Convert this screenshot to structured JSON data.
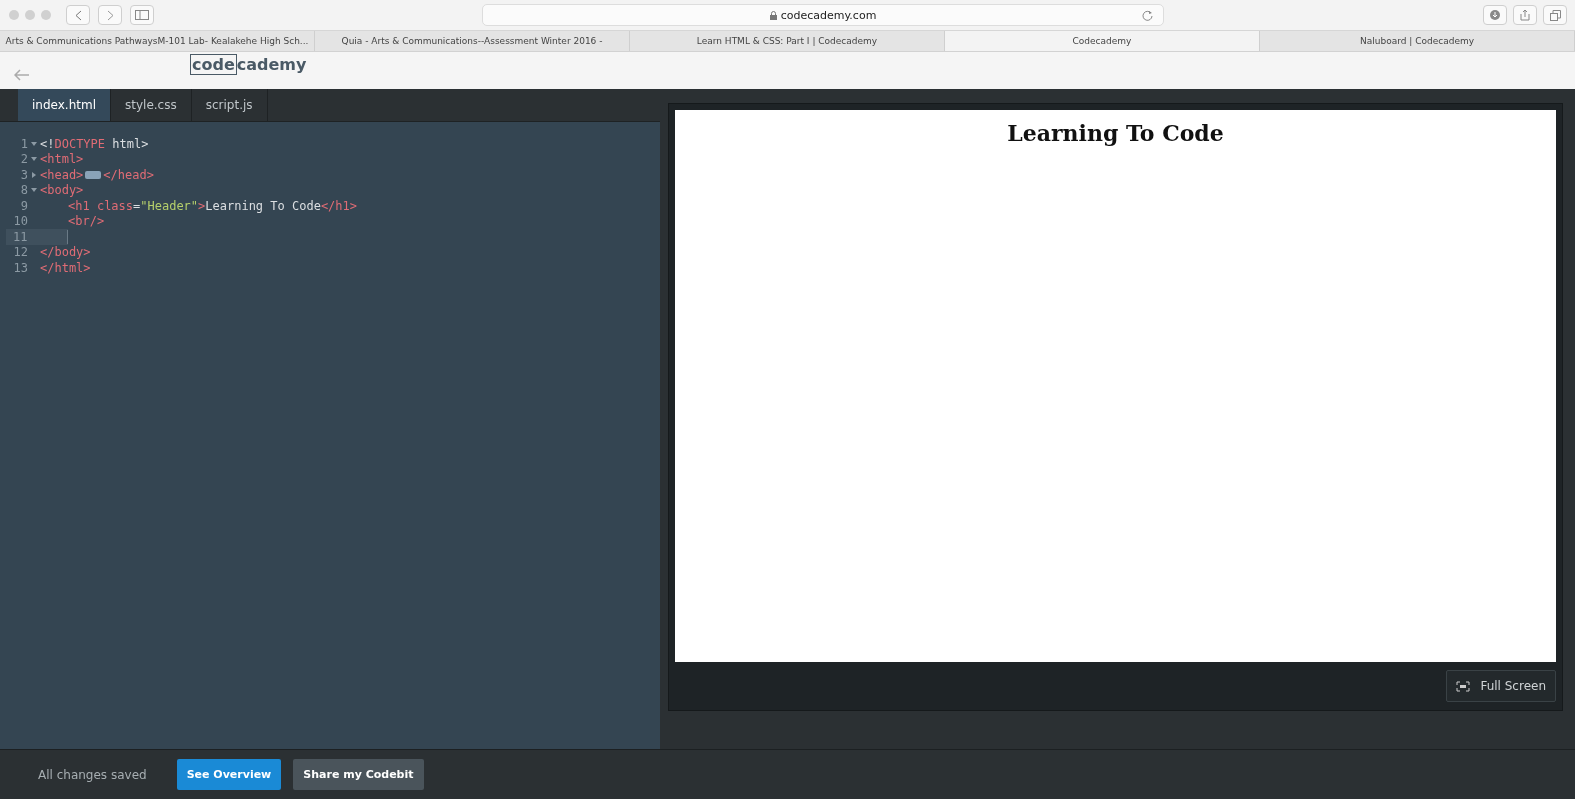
{
  "browser": {
    "address": "codecademy.com",
    "tabs": [
      {
        "label": "Arts & Communications PathwaysM-101 Lab- Kealakehe High Sch...",
        "selected": false
      },
      {
        "label": "Quia - Arts & Communications--Assessment Winter 2016 -",
        "selected": false
      },
      {
        "label": "Learn HTML & CSS: Part I | Codecademy",
        "selected": false
      },
      {
        "label": "Codecademy",
        "selected": true
      },
      {
        "label": "Naluboard | Codecademy",
        "selected": false
      }
    ]
  },
  "header": {
    "logo": [
      "code",
      "cademy"
    ]
  },
  "editor": {
    "tabs": [
      {
        "label": "index.html",
        "selected": true
      },
      {
        "label": "style.css",
        "selected": false
      },
      {
        "label": "script.js",
        "selected": false
      }
    ],
    "lines": [
      {
        "number": "1",
        "collapsed": false,
        "indented": false,
        "active": false,
        "tokens": [
          {
            "kind": "plain",
            "text": "<!"
          },
          {
            "kind": "tag",
            "text": "DOCTYPE"
          },
          {
            "kind": "plain",
            "text": " html>"
          }
        ]
      },
      {
        "number": "2",
        "collapsed": false,
        "indented": false,
        "active": false,
        "tokens": [
          {
            "kind": "tag",
            "text": "<html>"
          }
        ]
      },
      {
        "number": "3",
        "collapsed": true,
        "indented": false,
        "active": false,
        "tokens": [
          {
            "kind": "tag",
            "text": "<head>"
          },
          {
            "kind": "folded"
          },
          {
            "kind": "tag",
            "text": "</head>"
          }
        ]
      },
      {
        "number": "8",
        "collapsed": false,
        "indented": false,
        "active": false,
        "tokens": [
          {
            "kind": "tag",
            "text": "<body>"
          }
        ]
      },
      {
        "number": "9",
        "indented": true,
        "active": false,
        "tokens": [
          {
            "kind": "tag",
            "text": "<h1 "
          },
          {
            "kind": "tag",
            "text": "class"
          },
          {
            "kind": "plain",
            "text": "="
          },
          {
            "kind": "string",
            "text": "\"Header\""
          },
          {
            "kind": "tag",
            "text": ">"
          },
          {
            "kind": "plain",
            "text": "Learning To Code"
          },
          {
            "kind": "tag",
            "text": "</h1>"
          }
        ]
      },
      {
        "number": "10",
        "indented": true,
        "active": false,
        "tokens": [
          {
            "kind": "tag",
            "text": "<br/>"
          }
        ]
      },
      {
        "number": "11",
        "indented": true,
        "active": true
      },
      {
        "number": "12",
        "indented": false,
        "active": false,
        "tokens": [
          {
            "kind": "tag",
            "text": "</body>"
          }
        ]
      },
      {
        "number": "13",
        "indented": false,
        "active": false,
        "tokens": [
          {
            "kind": "tag",
            "text": "</html>"
          }
        ]
      }
    ]
  },
  "preview": {
    "heading": "Learning To Code",
    "fullscreen_button": "Full Screen"
  },
  "footer": {
    "status": "All changes saved",
    "buttons": [
      {
        "label": "See Overview",
        "kind": "primary"
      },
      {
        "label": "Share my Codebit",
        "kind": "secondary"
      }
    ]
  }
}
